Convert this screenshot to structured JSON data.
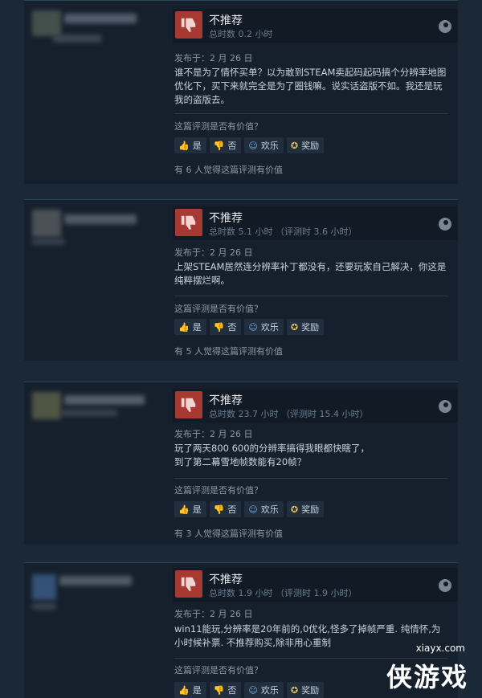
{
  "reviews": [
    {
      "verdict": "不推荐",
      "hours": "总时数 0.2 小时",
      "posted": "发布于：2 月 26 日",
      "content": "谁不是为了情怀买单？以为敢到STEAM卖起码起码搞个分辨率地图优化下，买下来就完全是为了圈钱嘛。说实话盗版不如。我还是玩我的盗版去。",
      "helpful_question": "这篇评测是否有价值？",
      "btn_yes": "是",
      "btn_no": "否",
      "btn_funny": "欢乐",
      "btn_award": "奖励",
      "helpful_count": "有 6 人觉得这篇评测有价值"
    },
    {
      "verdict": "不推荐",
      "hours": "总时数 5.1 小时 （评测时 3.6 小时）",
      "posted": "发布于：2 月 26 日",
      "content": "上架STEAM居然连分辨率补丁都没有，还要玩家自己解决，你这是纯粹摆烂啊。",
      "helpful_question": "这篇评测是否有价值？",
      "btn_yes": "是",
      "btn_no": "否",
      "btn_funny": "欢乐",
      "btn_award": "奖励",
      "helpful_count": "有 5 人觉得这篇评测有价值"
    },
    {
      "verdict": "不推荐",
      "hours": "总时数 23.7 小时 （评测时 15.4 小时）",
      "posted": "发布于：2 月 26 日",
      "content": "玩了两天800 600的分辨率搞得我眼都快瞎了，\n到了第二幕雪地帧数能有20帧？",
      "helpful_question": "这篇评测是否有价值？",
      "btn_yes": "是",
      "btn_no": "否",
      "btn_funny": "欢乐",
      "btn_award": "奖励",
      "helpful_count": "有 3 人觉得这篇评测有价值"
    },
    {
      "verdict": "不推荐",
      "hours": "总时数 1.9 小时 （评测时 1.9 小时）",
      "posted": "发布于：2 月 26 日",
      "content": "win11能玩,分辨率是20年前的,0优化,怪多了掉帧严重. 纯情怀,为小时候补票. 不推荐购买,除非用心重制",
      "helpful_question": "这篇评测是否有价值？",
      "btn_yes": "是",
      "btn_no": "否",
      "btn_funny": "欢乐",
      "btn_award": "奖励",
      "helpful_count": ""
    }
  ],
  "watermark": {
    "domain": "xiayx.com",
    "brand": "侠游戏"
  },
  "colors": {
    "thumb_down_bg": "#a63a33",
    "link_blue": "#66c0f4",
    "page_bg": "#1b2838"
  }
}
